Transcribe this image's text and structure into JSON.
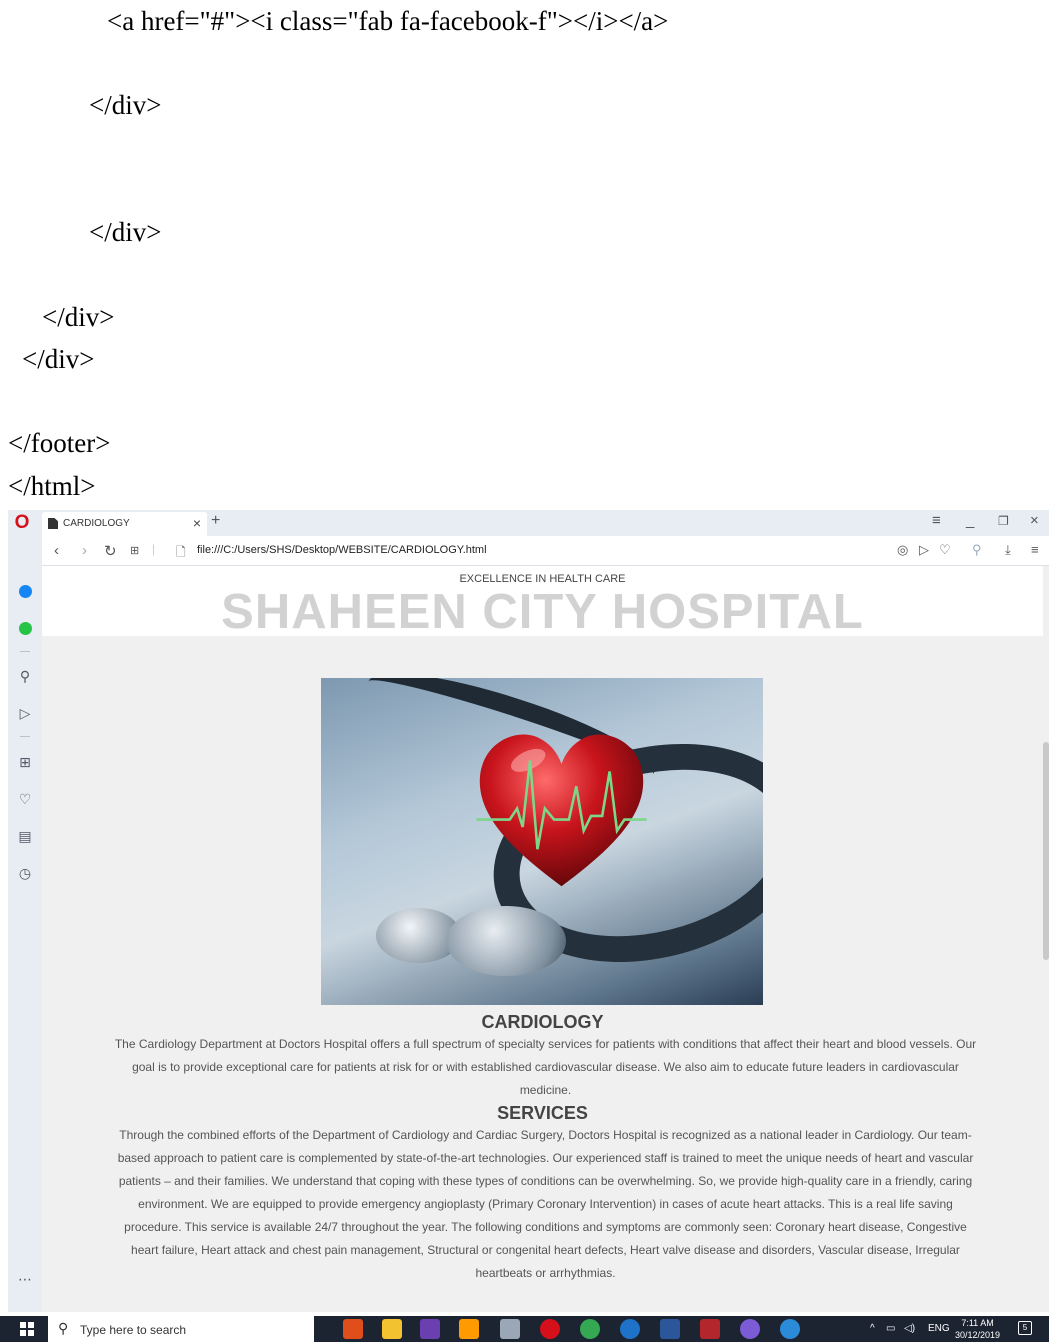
{
  "code_lines": [
    "<a href=\"#\"><i class=\"fab fa-facebook-f\"></i></a>",
    "</div>",
    "</div>",
    "</div>",
    "</div>",
    "</footer>",
    "</html>"
  ],
  "browser": {
    "tab_title": "CARDIOLOGY",
    "url": "file:///C:/Users/SHS/Desktop/WEBSITE/CARDIOLOGY.html"
  },
  "page": {
    "tagline": "EXCELLENCE IN HEALTH CARE",
    "hospital_name": "SHAHEEN CITY HOSPITAL",
    "cardiology": {
      "title": "CARDIOLOGY",
      "body": "The Cardiology Department at Doctors Hospital offers a full spectrum of specialty services for patients with conditions that affect their heart and blood vessels. Our goal is to provide exceptional care for patients at risk for or with established cardiovascular disease. We also aim to educate future leaders in cardiovascular medicine."
    },
    "services": {
      "title": "SERVICES",
      "body": "Through the combined efforts of the Department of Cardiology and Cardiac Surgery, Doctors Hospital is recognized as a national leader in Cardiology. Our team-based approach to patient care is complemented by state-of-the-art technologies. Our experienced staff is trained to meet the unique needs of heart and vascular patients – and their families. We understand that coping with these types of conditions can be overwhelming. So, we provide high-quality care in a friendly, caring environment. We are equipped to provide emergency angioplasty (Primary Coronary Intervention) in cases of acute heart attacks. This is a real life saving procedure. This service is available 24/7 throughout the year. The following conditions and symptoms are commonly seen: Coronary heart disease, Congestive heart failure, Heart attack and chest pain management, Structural or congenital heart defects, Heart valve disease and disorders, Vascular disease, Irregular heartbeats or arrhythmias."
    }
  },
  "taskbar": {
    "search_placeholder": "Type here to search",
    "language": "ENG",
    "time": "7:11 AM",
    "date": "30/12/2019",
    "notification_count": "5"
  },
  "colors": {
    "opera_red": "#d6101b",
    "sidebar_bg": "#e8edf3",
    "page_bg": "#f0f0f0",
    "hospital_name": "#d2d2d2",
    "taskbar_bg": "#1c2331"
  }
}
